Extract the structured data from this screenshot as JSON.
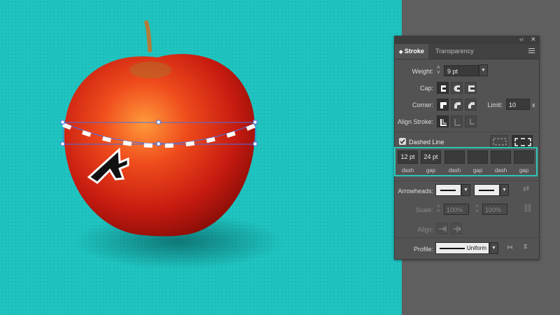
{
  "panel": {
    "top_controls": {
      "collapse": "‹‹",
      "close": "✕"
    },
    "tabs": [
      {
        "label": "Stroke",
        "prefix": "◆"
      },
      {
        "label": "Transparency"
      }
    ],
    "weight": {
      "label": "Weight:",
      "value": "9 pt"
    },
    "cap": {
      "label": "Cap:"
    },
    "corner": {
      "label": "Corner:"
    },
    "limit": {
      "label": "Limit:",
      "value": "10",
      "unit": "x"
    },
    "align_stroke": {
      "label": "Align Stroke:"
    },
    "dashed_line": {
      "label": "Dashed Line",
      "checked": true
    },
    "dash_fields": [
      {
        "value": "12 pt",
        "label": "dash"
      },
      {
        "value": "24 pt",
        "label": "gap"
      },
      {
        "value": "",
        "label": "dash"
      },
      {
        "value": "",
        "label": "gap"
      },
      {
        "value": "",
        "label": "dash"
      },
      {
        "value": "",
        "label": "gap"
      }
    ],
    "arrowheads": {
      "label": "Arrowheads:"
    },
    "scale": {
      "label": "Scale:",
      "start": "100%",
      "end": "100%"
    },
    "align": {
      "label": "Align:"
    },
    "profile": {
      "label": "Profile:",
      "value": "Uniform"
    }
  },
  "colors": {
    "canvas": "#1fc4c1",
    "highlight": "#2ec7b8",
    "panel": "#535353"
  }
}
